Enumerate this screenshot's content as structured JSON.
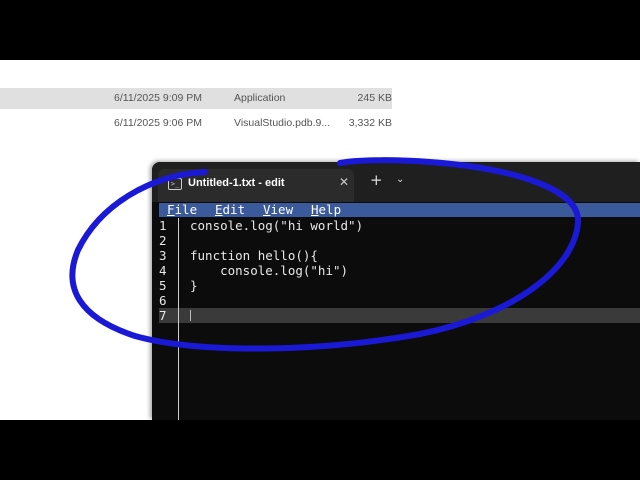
{
  "explorer": {
    "rows": [
      {
        "date": "6/11/2025 9:09 PM",
        "type": "Application",
        "size": "245 KB"
      },
      {
        "date": "6/11/2025 9:06 PM",
        "type": "VisualStudio.pdb.9...",
        "size": "3,332 KB"
      }
    ]
  },
  "terminal": {
    "tab_icon_glyph": ">_",
    "tab_title": "Untitled-1.txt - edit",
    "close_glyph": "✕",
    "new_tab_glyph": "+",
    "dropdown_glyph": "⌄"
  },
  "menu": {
    "file": {
      "key": "F",
      "rest": "ile"
    },
    "edit": {
      "key": "E",
      "rest": "dit"
    },
    "view": {
      "key": "V",
      "rest": "iew"
    },
    "help": {
      "key": "H",
      "rest": "elp"
    }
  },
  "editor": {
    "lines": [
      {
        "num": "1",
        "text": "console.log(\"hi world\")"
      },
      {
        "num": "2",
        "text": ""
      },
      {
        "num": "3",
        "text": "function hello(){"
      },
      {
        "num": "4",
        "text": "    console.log(\"hi\")"
      },
      {
        "num": "5",
        "text": "}"
      },
      {
        "num": "6",
        "text": ""
      },
      {
        "num": "7",
        "text": ""
      }
    ]
  },
  "colors": {
    "menu_bar": "#3a5a9c",
    "annotation_stroke": "#1a1ad6",
    "terminal_bg": "#0c0c0c"
  }
}
